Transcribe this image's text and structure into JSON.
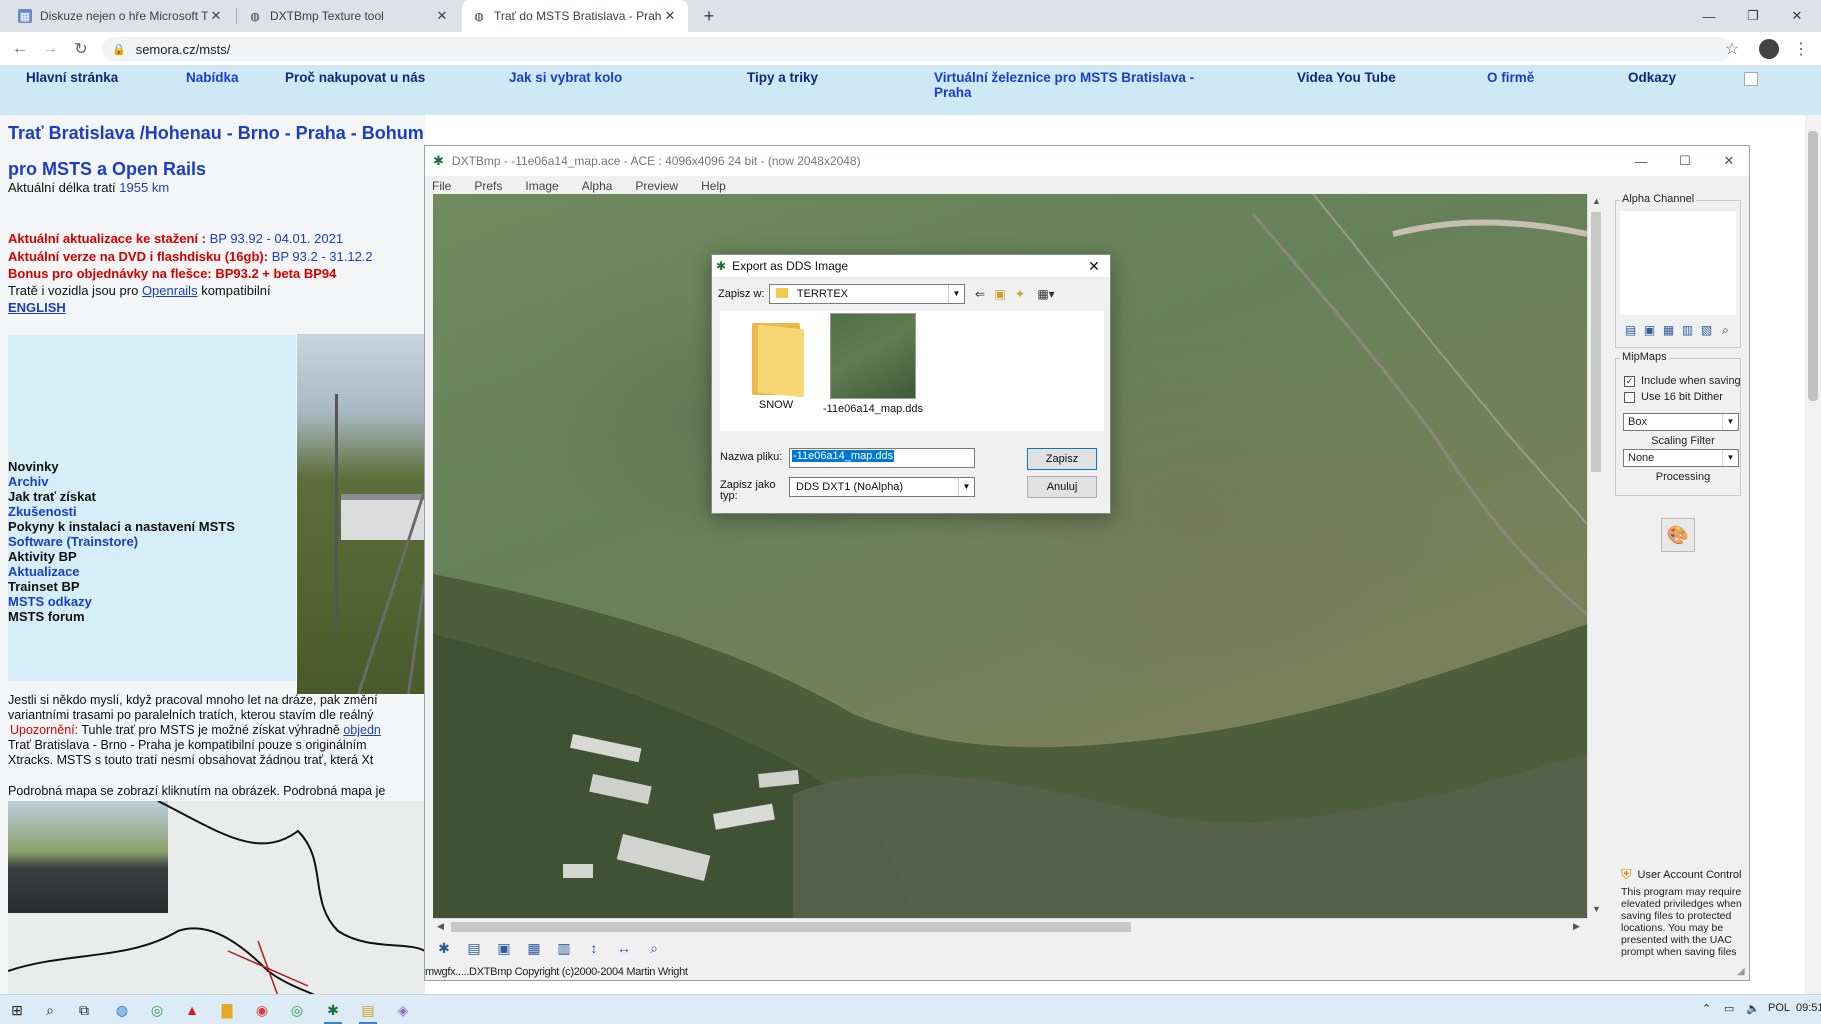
{
  "browser": {
    "tabs": [
      {
        "title": "Diskuze nejen o hře Microsoft Tr",
        "icon": "forum-favicon-icon"
      },
      {
        "title": "DXTBmp Texture tool",
        "icon": "globe-icon"
      },
      {
        "title": "Trať do MSTS Bratislava - Praha",
        "icon": "globe-icon"
      }
    ],
    "url": "semora.cz/msts/"
  },
  "site_nav": {
    "items": [
      "Hlavní stránka",
      "Nabídka",
      "Proč nakupovat u nás",
      "Jak si vybrat kolo",
      "Tipy a triky",
      "Virtuální železnice pro MSTS Bratislava - Praha",
      "Videa You Tube",
      "O firmě",
      "Odkazy"
    ]
  },
  "page": {
    "heading1": "Trať Bratislava /Hohenau - Brno - Praha - Bohumín",
    "heading2": "pro MSTS a Open Rails",
    "length_label": "Aktuální délka tratí",
    "length_value": "1955 km",
    "update_label": "Aktuální aktualizace ke stažení :",
    "update_value": "BP 93.92 - 04.01. 2021",
    "dvd_label": "Aktuální verze na DVD i flashdisku (16gb):",
    "dvd_value": "BP 93.2 - 31.12.2",
    "bonus": "Bonus pro objednávky na flešce: BP93.2 + beta BP94",
    "compat_pre": "Tratě i vozidla jsou pro",
    "compat_link": "Openrails",
    "compat_post": "kompatibilní",
    "english": "ENGLISH",
    "menu": [
      {
        "label": "Novinky",
        "style": "dark"
      },
      {
        "label": "Archiv",
        "style": "blue"
      },
      {
        "label": "Jak trať získat",
        "style": "dark"
      },
      {
        "label": "Zkušenosti",
        "style": "blue"
      },
      {
        "label": "Pokyny k instalaci a nastavení MSTS",
        "style": "dark"
      },
      {
        "label": "Software  (Trainstore)",
        "style": "blue"
      },
      {
        "label": "Aktivity BP",
        "style": "dark"
      },
      {
        "label": "Aktualizace",
        "style": "blue"
      },
      {
        "label": "Trainset BP",
        "style": "dark"
      },
      {
        "label": "MSTS odkazy",
        "style": "blue"
      },
      {
        "label": "MSTS forum",
        "style": "dark"
      }
    ],
    "para1": "Jestli si někdo myslí, když pracoval mnoho let na dráze, pak změní",
    "para2": "variantními trasami po paralelních tratích, kterou stavím dle reálný",
    "warn_label": "Upozornění:",
    "warn_text": "Tuhle trať pro MSTS je možné získat výhradně",
    "warn_link": "objedn",
    "para3": "Trať Bratislava - Brno - Praha je kompatibilní pouze s originálním",
    "para4": "Xtracks.  MSTS s touto tratí nesmí obsahovat žádnou trať, která Xt",
    "map_note": "Podrobná mapa se zobrazí kliknutím na obrázek. Podrobná mapa je"
  },
  "dxtbmp": {
    "title": "DXTBmp - -11e06a14_map.ace - ACE : 4096x4096 24 bit - (now 2048x2048)",
    "menu": [
      "File",
      "Prefs",
      "Image",
      "Alpha",
      "Preview",
      "Help"
    ],
    "status": "mwgfx.....DXTBmp Copyright (c)2000-2004 Martin Wright",
    "panel": {
      "alpha_channel": "Alpha Channel",
      "mipmaps": "MipMaps",
      "include_when_saving": "Include when saving",
      "include_checked": true,
      "use_16bit_dither": "Use 16 bit Dither",
      "filter_value": "Box",
      "scaling_filter": "Scaling Filter",
      "processing_value": "None",
      "processing": "Processing",
      "uac_title": "User Account Control",
      "uac_text": "This program may require elevated priviledges when saving files to protected locations. You may be presented with the UAC prompt when saving files"
    }
  },
  "dialog": {
    "title": "Export as DDS Image",
    "save_in_label": "Zapisz w:",
    "save_in_value": "TERRTEX",
    "files": [
      {
        "name": "SNOW",
        "kind": "folder"
      },
      {
        "name": "-11e06a14_map.dds",
        "kind": "image"
      }
    ],
    "filename_label": "Nazwa pliku:",
    "filename_value": "-11e06a14_map.dds",
    "type_label": "Zapisz jako typ:",
    "type_value": "DDS DXT1 (NoAlpha)",
    "save_button": "Zapisz",
    "cancel_button": "Anuluj"
  },
  "taskbar": {
    "lang": "POL",
    "time": "09:51"
  }
}
